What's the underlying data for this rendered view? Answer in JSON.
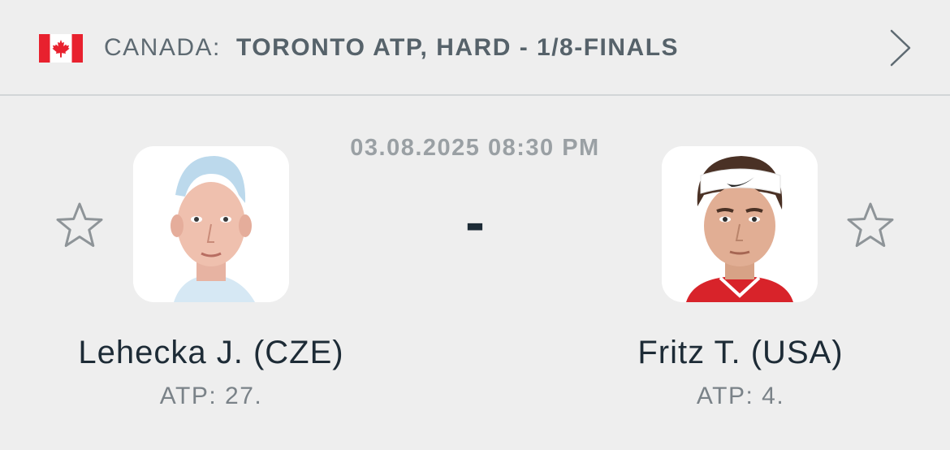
{
  "header": {
    "flag_icon": "canada-flag-icon",
    "country": "CANADA:",
    "tournament": "TORONTO ATP, HARD - 1/8-FINALS",
    "chevron_icon": "chevron-right-icon"
  },
  "match": {
    "datetime": "03.08.2025 08:30 PM",
    "score": "-"
  },
  "home": {
    "name": "Lehecka J. (CZE)",
    "rank": "ATP: 27.",
    "favorite_icon": "star-outline-icon"
  },
  "away": {
    "name": "Fritz T. (USA)",
    "rank": "ATP: 4.",
    "favorite_icon": "star-outline-icon"
  },
  "colors": {
    "background": "#eeeeee",
    "text_dark": "#1d2b36",
    "text_muted": "#7a8288",
    "divider": "#d2d5d7",
    "flag_red": "#e8212e"
  }
}
